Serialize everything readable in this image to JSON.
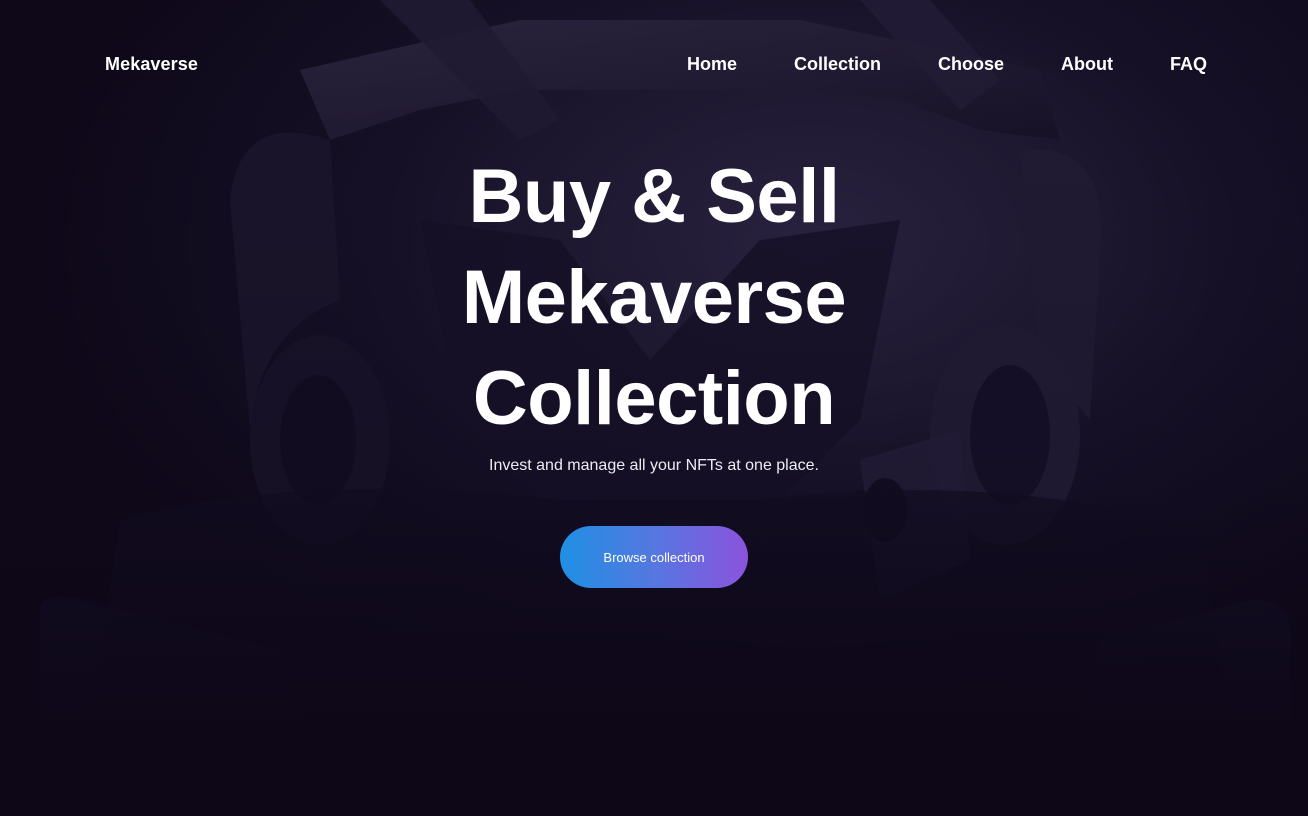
{
  "header": {
    "brand": "Mekaverse",
    "nav": [
      {
        "label": "Home"
      },
      {
        "label": "Collection"
      },
      {
        "label": "Choose"
      },
      {
        "label": "About"
      },
      {
        "label": "FAQ"
      }
    ]
  },
  "hero": {
    "title_lines": [
      "Buy & Sell",
      "Mekaverse",
      "Collection"
    ],
    "subtitle": "Invest and manage all your NFTs at one place.",
    "cta_label": "Browse collection"
  },
  "colors": {
    "background": "#0e0819",
    "text": "#ffffff",
    "cta_gradient_start": "#1f90e4",
    "cta_gradient_end": "#8b53dd"
  }
}
